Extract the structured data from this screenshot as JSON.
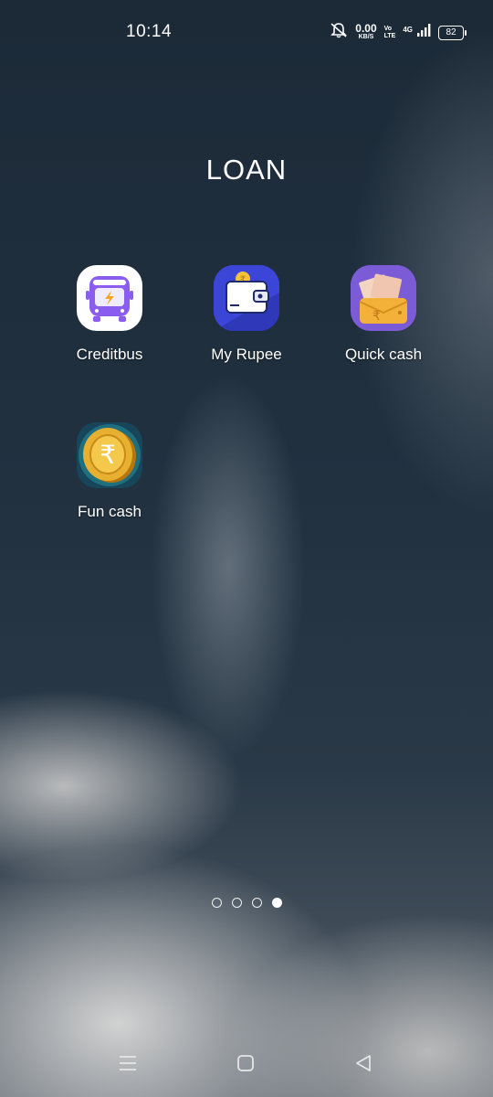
{
  "status_bar": {
    "time": "10:14",
    "net_speed_value": "0.00",
    "net_speed_unit": "KB/S",
    "volte_top": "Vo",
    "volte_bottom": "LTE",
    "network_type": "4G",
    "battery_level": "82"
  },
  "folder": {
    "title": "LOAN",
    "apps": [
      {
        "label": "Creditbus",
        "icon": "creditbus-bus-icon"
      },
      {
        "label": "My Rupee",
        "icon": "wallet-icon"
      },
      {
        "label": "Quick cash",
        "icon": "cash-envelope-icon"
      },
      {
        "label": "Fun cash",
        "icon": "rupee-coin-icon"
      }
    ]
  },
  "page_indicator": {
    "total_pages": 4,
    "active_page": 4
  },
  "colors": {
    "creditbus_purple": "#8a5cf0",
    "myrupee_blue": "#3b46d8",
    "quickcash_purple": "#7b5bd6",
    "coin_gold": "#e8b030"
  }
}
